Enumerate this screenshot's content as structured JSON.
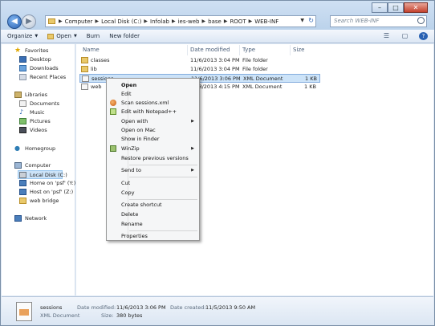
{
  "window": {
    "minimize_glyph": "–",
    "maximize_glyph": "□",
    "close_glyph": "✕"
  },
  "address": {
    "crumbs": [
      "Computer",
      "Local Disk (C:)",
      "Infolab",
      "ies-web",
      "base",
      "ROOT",
      "WEB-INF"
    ]
  },
  "search": {
    "placeholder": "Search WEB-INF"
  },
  "toolbar": {
    "organize": "Organize",
    "open": "Open",
    "burn": "Burn",
    "new_folder": "New folder"
  },
  "nav": {
    "favorites": "Favorites",
    "desktop": "Desktop",
    "downloads": "Downloads",
    "recent_places": "Recent Places",
    "libraries": "Libraries",
    "documents": "Documents",
    "music": "Music",
    "pictures": "Pictures",
    "videos": "Videos",
    "homegroup": "Homegroup",
    "computer": "Computer",
    "local_disk": "Local Disk (C:)",
    "home_psf": "Home on 'psf' (Y:)",
    "host_psf": "Host on 'psf' (Z:)",
    "web_bridge": "web bridge",
    "network": "Network"
  },
  "columns": {
    "name": "Name",
    "date_modified": "Date modified",
    "type": "Type",
    "size": "Size"
  },
  "files": [
    {
      "name": "classes",
      "date": "11/6/2013 3:04 PM",
      "type": "File folder",
      "size": ""
    },
    {
      "name": "lib",
      "date": "11/6/2013 3:04 PM",
      "type": "File folder",
      "size": ""
    },
    {
      "name": "sessions",
      "date": "11/6/2013 3:06 PM",
      "type": "XML Document",
      "size": "1 KB"
    },
    {
      "name": "web",
      "date": "11/8/2013 4:15 PM",
      "type": "XML Document",
      "size": "1 KB"
    }
  ],
  "context_menu": {
    "open": "Open",
    "edit": "Edit",
    "scan": "Scan sessions.xml",
    "edit_npp": "Edit with Notepad++",
    "open_with": "Open with",
    "open_on_mac": "Open on Mac",
    "show_in_finder": "Show in Finder",
    "winzip": "WinZip",
    "restore": "Restore previous versions",
    "send_to": "Send to",
    "cut": "Cut",
    "copy": "Copy",
    "create_shortcut": "Create shortcut",
    "delete": "Delete",
    "rename": "Rename",
    "properties": "Properties"
  },
  "details": {
    "name": "sessions",
    "type": "XML Document",
    "date_modified_label": "Date modified:",
    "date_modified": "11/6/2013 3:06 PM",
    "size_label": "Size:",
    "size": "380 bytes",
    "date_created_label": "Date created:",
    "date_created": "11/5/2013 9:50 AM"
  }
}
